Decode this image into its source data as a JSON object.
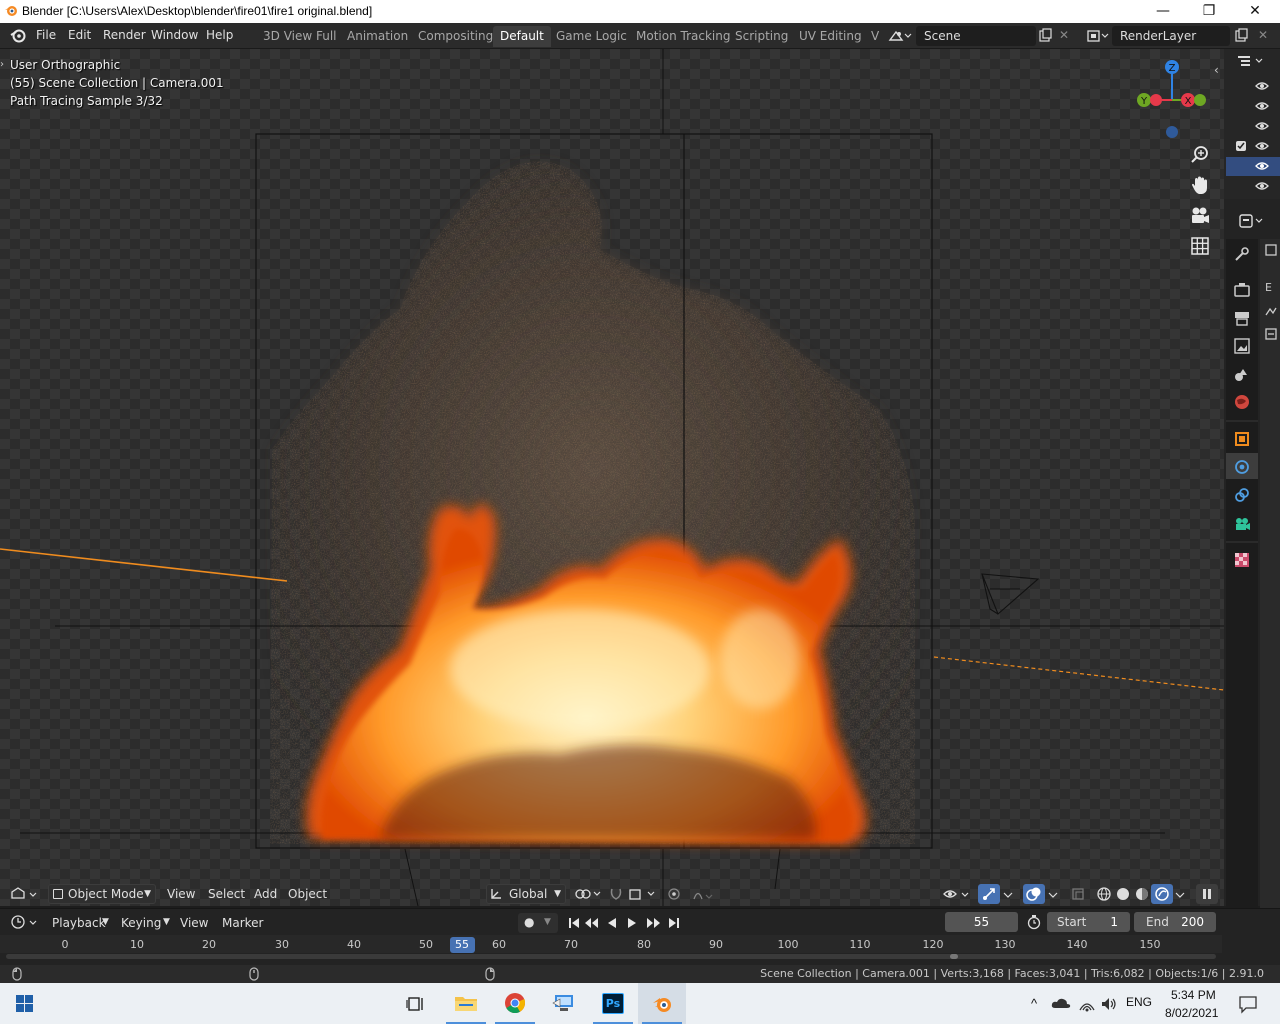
{
  "window": {
    "title": "Blender [C:\\Users\\Alex\\Desktop\\blender\\fire01\\fire1 original.blend]",
    "minimize": "—",
    "maximize": "❐",
    "close": "✕"
  },
  "menu": {
    "items": [
      "File",
      "Edit",
      "Render",
      "Window",
      "Help"
    ]
  },
  "workspaces": {
    "tabs": [
      "3D View Full",
      "Animation",
      "Compositing",
      "Default",
      "Game Logic",
      "Motion Tracking",
      "Scripting",
      "UV Editing",
      "V"
    ],
    "active": "Default"
  },
  "scene": {
    "name": "Scene"
  },
  "view_layer": {
    "name": "RenderLayer"
  },
  "viewport": {
    "view_name": "User Orthographic",
    "collection_info": "(55) Scene Collection | Camera.001",
    "render_status": "Path Tracing Sample 3/32",
    "gizmo": {
      "z": "Z",
      "y": "Y",
      "x": "X"
    }
  },
  "viewport_header": {
    "mode": "Object Mode",
    "menus": [
      "View",
      "Select",
      "Add",
      "Object"
    ],
    "transform_orientation": "Global"
  },
  "timeline": {
    "menus": [
      "Playback",
      "Keying",
      "View",
      "Marker"
    ],
    "current_frame": "55",
    "start_label": "Start",
    "start": "1",
    "end_label": "End",
    "end": "200",
    "ticks": [
      "0",
      "10",
      "20",
      "30",
      "40",
      "50",
      "55",
      "60",
      "70",
      "80",
      "90",
      "100",
      "110",
      "120",
      "130",
      "140",
      "150"
    ]
  },
  "status_bar": {
    "text": "Scene Collection | Camera.001 | Verts:3,168 | Faces:3,041 | Tris:6,082 | Objects:1/6 | 2.91.0"
  },
  "taskbar": {
    "language": "ENG",
    "time": "5:34 PM",
    "date": "8/02/2021",
    "apps": [
      "start-icon",
      "task-view-icon",
      "file-explorer-icon",
      "chrome-icon",
      "remote-desktop-icon",
      "photoshop-icon",
      "blender-icon"
    ]
  },
  "properties_tab_letter": "E",
  "colors": {
    "accent_blue": "#4772b3",
    "axis_z": "#2f83e4",
    "axis_y": "#6ea723",
    "axis_x": "#e6394a",
    "fire_core": "#fff3c4",
    "fire_edge": "#ff6a00"
  }
}
